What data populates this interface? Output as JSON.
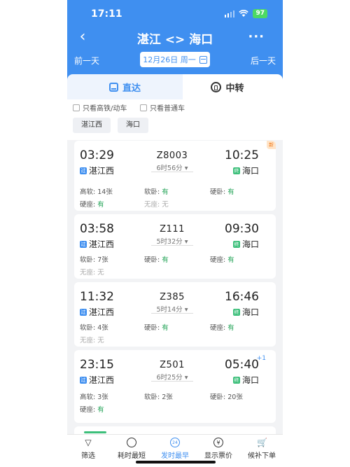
{
  "status_bar": {
    "time": "17:11",
    "battery": "97"
  },
  "header": {
    "title": "湛江 <> 海口",
    "more": "···",
    "prev_day": "前一天",
    "next_day": "后一天",
    "date": "12月26日 周一"
  },
  "tabs": {
    "direct": "直达",
    "transfer": "中转"
  },
  "filters": {
    "checkbox_hsr": "只看高铁/动车",
    "checkbox_normal": "只看普通车",
    "chip_from": "湛江西",
    "chip_to": "海口"
  },
  "trains": [
    {
      "dep_time": "03:29",
      "arr_time": "10:25",
      "number": "Z8003",
      "duration": "6时56分",
      "from": "湛江西",
      "to": "海口",
      "from_badge": "过",
      "to_badge": "终",
      "tag": "新",
      "extra": "",
      "seats_row1": [
        {
          "name": "高软:",
          "value": "14张"
        },
        {
          "name": "软卧:",
          "value": "有"
        },
        {
          "name": "硬卧:",
          "value": "有"
        }
      ],
      "seats_row2": [
        {
          "name": "硬座:",
          "value": "有"
        },
        {
          "name": "无座:",
          "value": "无"
        }
      ]
    },
    {
      "dep_time": "03:58",
      "arr_time": "09:30",
      "number": "Z111",
      "duration": "5时32分",
      "from": "湛江西",
      "to": "海口",
      "from_badge": "过",
      "to_badge": "终",
      "tag": "",
      "extra": "",
      "seats_row1": [
        {
          "name": "软卧:",
          "value": "7张"
        },
        {
          "name": "硬卧:",
          "value": "有"
        },
        {
          "name": "硬座:",
          "value": "有"
        }
      ],
      "seats_row2": [
        {
          "name": "无座:",
          "value": "无"
        }
      ]
    },
    {
      "dep_time": "11:32",
      "arr_time": "16:46",
      "number": "Z385",
      "duration": "5时14分",
      "from": "湛江西",
      "to": "海口",
      "from_badge": "过",
      "to_badge": "终",
      "tag": "",
      "extra": "",
      "seats_row1": [
        {
          "name": "软卧:",
          "value": "4张"
        },
        {
          "name": "硬卧:",
          "value": "有"
        },
        {
          "name": "硬座:",
          "value": "有"
        }
      ],
      "seats_row2": [
        {
          "name": "无座:",
          "value": "无"
        }
      ]
    },
    {
      "dep_time": "23:15",
      "arr_time": "05:40",
      "number": "Z501",
      "duration": "6时25分",
      "from": "湛江西",
      "to": "海口",
      "from_badge": "过",
      "to_badge": "终",
      "tag": "",
      "extra": "+1",
      "seats_row1": [
        {
          "name": "高软:",
          "value": "3张"
        },
        {
          "name": "软卧:",
          "value": "2张"
        },
        {
          "name": "硬卧:",
          "value": "20张"
        }
      ],
      "seats_row2": [
        {
          "name": "硬座:",
          "value": "有"
        }
      ]
    }
  ],
  "bottom_bar": {
    "filter": "筛选",
    "shortest": "耗时最短",
    "earliest": "发时最早",
    "show_price": "显示票价",
    "waitlist": "候补下单",
    "earliest_icon_text": "24"
  },
  "colors": {
    "brand_blue": "#3f8ff0",
    "ok_green": "#22a356",
    "end_badge": "#3cbf7a"
  }
}
